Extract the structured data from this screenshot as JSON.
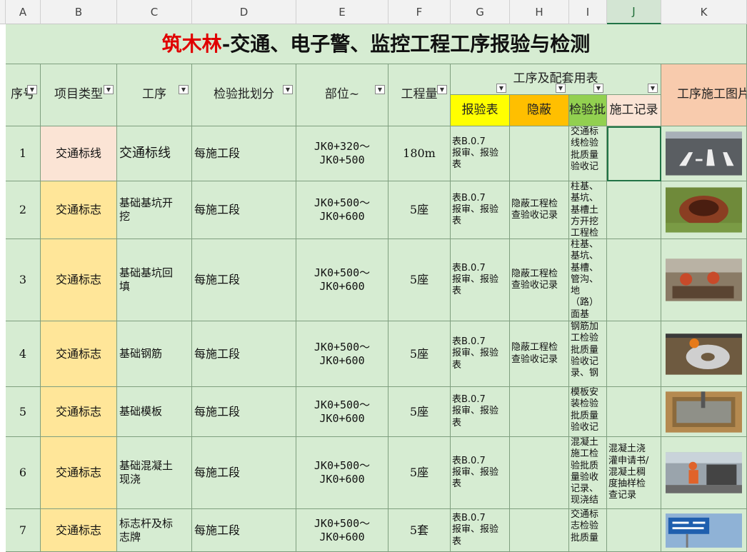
{
  "column_letters": [
    "A",
    "B",
    "C",
    "D",
    "E",
    "F",
    "G",
    "H",
    "I",
    "J",
    "K"
  ],
  "title": {
    "brand": "筑木林",
    "rest": "-交通、电子警、监控工程工序报验与检测"
  },
  "headers": {
    "seq": "序号",
    "type": "项目类型",
    "process": "工序",
    "batch": "检验批划分",
    "part": "部位~",
    "qty": "工程量",
    "forms_group": "工序及配套用表",
    "form_g": "报验表",
    "form_h": "隐蔽",
    "form_i": "检验批",
    "form_j": "施工记录",
    "photo": "工序施工图片"
  },
  "colors": {
    "grid_green": "#d6ecd2",
    "header_yellow": "#ffff00",
    "header_orange": "#ffbf00",
    "header_green": "#92d050",
    "header_peach": "#fbe4d5",
    "photo_header": "#f8cbad",
    "type_pink": "#fbe4d5",
    "type_yellow": "#ffe699",
    "brand_red": "#e00000"
  },
  "rows": [
    {
      "seq": "1",
      "type": "交通标线",
      "process": "交通标线",
      "batch": "每施工段",
      "part": "JK0+320～\nJK0+500",
      "qty": "180m",
      "form_g": "表B.0.7\n报审、报验\n表",
      "form_h": "",
      "form_i": "交通标\n线检验\n批质量\n验收记",
      "form_j": "",
      "photo": "road-markings-photo"
    },
    {
      "seq": "2",
      "type": "交通标志",
      "process": "基础基坑开\n挖",
      "batch": "每施工段",
      "part": "JK0+500～\nJK0+600",
      "qty": "5座",
      "form_g": "表B.0.7\n报审、报验\n表",
      "form_h": "隐蔽工程检\n查验收记录",
      "form_i": "柱基、\n基坑、\n基槽土\n方开挖\n工程检",
      "form_j": "",
      "photo": "excavation-photo"
    },
    {
      "seq": "3",
      "type": "交通标志",
      "process": "基础基坑回\n填",
      "batch": "每施工段",
      "part": "JK0+500～\nJK0+600",
      "qty": "5座",
      "form_g": "表B.0.7\n报审、报验\n表",
      "form_h": "隐蔽工程检\n查验收记录",
      "form_i": "柱基、\n基坑、\n基槽、\n管沟、\n地\n（路）\n面基",
      "form_j": "",
      "photo": "backfill-photo"
    },
    {
      "seq": "4",
      "type": "交通标志",
      "process": "基础钢筋",
      "batch": "每施工段",
      "part": "JK0+500～\nJK0+600",
      "qty": "5座",
      "form_g": "表B.0.7\n报审、报验\n表",
      "form_h": "隐蔽工程检\n查验收记录",
      "form_i": "钢筋加\n工检验\n批质量\n验收记\n录、钢",
      "form_j": "",
      "photo": "rebar-photo"
    },
    {
      "seq": "5",
      "type": "交通标志",
      "process": "基础模板",
      "batch": "每施工段",
      "part": "JK0+500～\nJK0+600",
      "qty": "5座",
      "form_g": "表B.0.7\n报审、报验\n表",
      "form_h": "",
      "form_i": "模板安\n装检验\n批质量\n验收记",
      "form_j": "",
      "photo": "formwork-photo"
    },
    {
      "seq": "6",
      "type": "交通标志",
      "process": "基础混凝土\n现浇",
      "batch": "每施工段",
      "part": "JK0+500～\nJK0+600",
      "qty": "5座",
      "form_g": "表B.0.7\n报审、报验\n表",
      "form_h": "",
      "form_i": "混凝土\n施工检\n验批质\n量验收\n记录、\n现浇结",
      "form_j": "混凝土浇\n灌申请书/\n混凝土稠\n度抽样检\n查记录",
      "photo": "concrete-pour-photo"
    },
    {
      "seq": "7",
      "type": "交通标志",
      "process": "标志杆及标\n志牌",
      "batch": "每施工段",
      "part": "JK0+500～\nJK0+600",
      "qty": "5套",
      "form_g": "表B.0.7\n报审、报验\n表",
      "form_h": "",
      "form_i": "交通标\n志检验\n批质量",
      "form_j": "",
      "photo": "sign-pole-photo"
    }
  ]
}
